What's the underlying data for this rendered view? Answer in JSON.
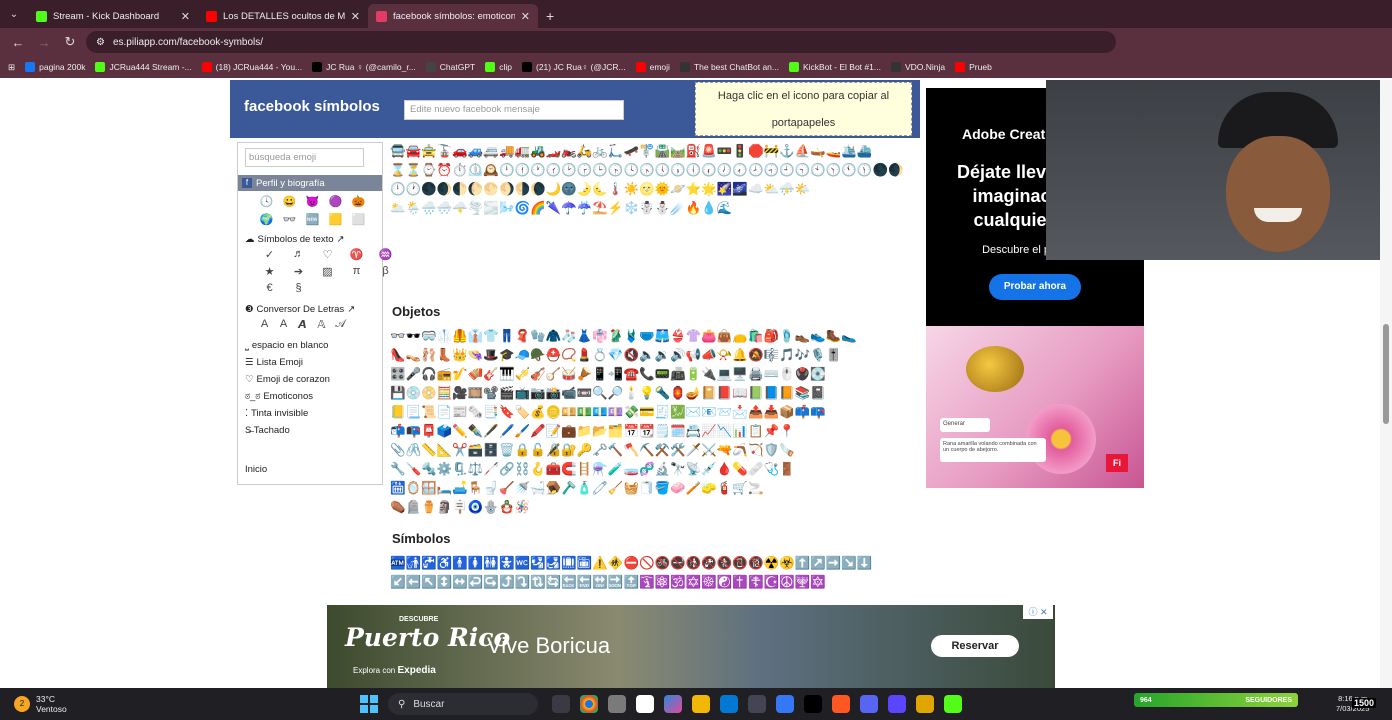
{
  "tabs": [
    {
      "title": "Stream - Kick Dashboard",
      "color": "#53fc18",
      "active": false
    },
    {
      "title": "Los DETALLES ocultos de MUJE",
      "color": "#ff0000",
      "active": false
    },
    {
      "title": "facebook símbolos: emoticone",
      "color": "#e33b66",
      "active": true
    }
  ],
  "tab_close": "✕",
  "new_tab": "+",
  "tab_menu": "⌄",
  "nav": {
    "back": "←",
    "forward": "→",
    "reload": "↻",
    "site_info": "⚙"
  },
  "url": "es.piliapp.com/facebook-symbols/",
  "bookmarks_icon": "⊞",
  "bookmarks": [
    {
      "label": "pagina 200k",
      "color": "#1877f2"
    },
    {
      "label": "JCRua444 Stream -...",
      "color": "#53fc18"
    },
    {
      "label": "(18) JCRua444 - You...",
      "color": "#ff0000"
    },
    {
      "label": "JC Rua ♀ (@camilo_r...",
      "color": "#000000"
    },
    {
      "label": "ChatGPT",
      "color": "#444444"
    },
    {
      "label": "clip",
      "color": "#53fc18"
    },
    {
      "label": "(21) JC Rua♀ (@JCR...",
      "color": "#000000"
    },
    {
      "label": "emoji",
      "color": "#ff0000"
    },
    {
      "label": "The best ChatBot an...",
      "color": "#333333"
    },
    {
      "label": "KickBot - El Bot #1...",
      "color": "#53fc18"
    },
    {
      "label": "VDO.Ninja",
      "color": "#333333"
    },
    {
      "label": "Prueb",
      "color": "#ff0000"
    }
  ],
  "header": {
    "logo": "facebook símbolos",
    "input_placeholder": "Edite nuevo facebook mensaje",
    "copy_hint_line1": "Haga clic en el icono para copiar al",
    "copy_hint_line2": "portapapeles"
  },
  "sidebar": {
    "search_placeholder": "búsqueda emoji",
    "profile_badge": "f",
    "profile_label": "Perfil y biografía",
    "icons": [
      "🕓",
      "😀",
      "😈",
      "🟣",
      "🎃",
      "🌍",
      "👓",
      "🆕",
      "🟨",
      "⬜"
    ],
    "text_symbols_icon": "☁",
    "text_symbols_label": "Símbolos de texto",
    "external_icon": "↗",
    "text_symbols": [
      "✓",
      "♬",
      "♡",
      "♈",
      "♒",
      "★",
      "➔",
      "▨",
      "π",
      "β",
      "€",
      "§"
    ],
    "letter_icon": "❸",
    "letter_converter": "Conversor De Letras",
    "blank_icon": "⎵",
    "blank_space": "espacio en blanco",
    "list_icon": "☰",
    "emoji_list": "Lista Emoji",
    "heart_icon": "♡",
    "heart_emoji": "Emoji de corazon",
    "emoticon_icon": "ಠ_ಠ",
    "emoticons": "Emoticonos",
    "ink_icon": "⁚",
    "invisible_ink": "Tinta invisible",
    "strike_label": "S̶ Tachado",
    "home": "Inicio"
  },
  "content": {
    "travel_rows": [
      "🚍🚘🚖🚡🚗🚙🚐🚚🚛🚜🏎️🏍️🛵🚲🛴🛹🚏🛣️🛤️⛽🚨🚥🚦🛑🚧⚓⛵🛶🚤🛳️⛴️",
      "⌛⏳⌚⏰⏱️⏲️🕰️🕛🕧🕐🕜🕑🕝🕒🕞🕓🕟🕔🕠🕕🕡🕖🕢🕗🕣🕘🕤🕙🕥🕚🕦🌑🌒",
      "🕛🕐🌑🌒🌓🌔🌕🌖🌗🌘🌙🌚🌛🌜🌡️☀️🌝🌞🪐⭐🌟🌠🌌☁️⛅⛈️🌤️",
      "🌥️🌦️🌧️🌨️🌩️🌪️🌫️🌬️🌀🌈🌂☂️☔⛱️⚡❄️☃️⛄☄️🔥💧🌊"
    ],
    "objects_title": "Objetos",
    "objects_rows": [
      "👓🕶️🥽🥼🦺👔👕👖🧣🧤🧥🧦👗👘🥻🩱🩲🩳👙👚👛👜👝🛍️🎒🩴👞👟🥾🥿",
      "👠👡🩰👢👑👒🎩🎓🧢🪖⛑️📿💄💍💎🔇🔈🔉🔊📢📣📯🔔🔕🎼🎵🎶🎙️🎚️",
      "🎛️🎤🎧📻🎷🪗🎸🎹🎺🎻🪕🥁🪘📱📲☎️📞📟📠🔋🔌💻🖥️🖨️⌨️🖱️🖲️💽",
      "💾💿📀🧮🎥🎞️📽️🎬📺📷📸📹📼🔍🔎🕯️💡🔦🏮🪔📔📕📖📗📘📙📚📓",
      "📒📃📜📄📰🗞️📑🔖🏷️💰🪙💴💵💶💷💸💳🧾💹✉️📧📨📩📤📥📦📫📪",
      "📬📭📮🗳️✏️✒️🖋️🖊️🖌️🖍️📝💼📁📂🗂️📅📆🗒️🗓️📇📈📉📊📋📌📍",
      "📎🖇️📏📐✂️🗃️🗄️🗑️🔒🔓🔏🔐🔑🗝️🔨🪓⛏️⚒️🛠️🗡️⚔️🔫🪃🏹🛡️🪚",
      "🔧🪛🔩⚙️🗜️⚖️🦯🔗⛓️🪝🧰🧲🪜⚗️🧪🧫🧬🔬🔭📡💉🩸💊🩹🩺🚪",
      "🛗🪞🪟🛏️🛋️🪑🚽🪠🚿🛁🪤🪒🧴🧷🧹🧺🧻🪣🧼🪥🧽🧯🛒🚬",
      "⚰️🪦⚱️🗿🪧🧿🪬🪆🪅"
    ],
    "symbols_title": "Símbolos",
    "symbols_rows": [
      "🏧🚮🚰♿🚹🚺🚻🚼🚾🛂🛃🛄🛅⚠️🚸⛔🚫🚳🚭🚯🚱🚷📵🔞☢️☣️⬆️↗️➡️↘️⬇️",
      "↙️⬅️↖️↕️↔️↩️↪️⤴️⤵️🔃🔄🔙🔚🔛🔜🔝🛐⚛️🕉️✡️☸️☯️✝️☦️☪️☮️🕎🔯"
    ],
    "collapse_icon": "⌄"
  },
  "ad_right": {
    "brand": "Adobe Creative Cloud",
    "headline": "Déjate llevar por tu imaginación en cualquier lugar",
    "sub": "Descubre el plan Pro.",
    "cta": "Probar ahora",
    "gen_label": "Generar",
    "prompt_text": "Rana amarilla volando combinada con un cuerpo de abejorro.",
    "badge": "Fi"
  },
  "bottom_ad": {
    "descubre": "DESCUBRE",
    "brand": "Puerto Rico",
    "explora": "Explora con",
    "expedia": "Expedia",
    "slogan": "Vive Boricua",
    "cta": "Reservar",
    "close": "ⓘ ✕"
  },
  "taskbar": {
    "temp": "33°C",
    "condition": "Ventoso",
    "weather_badge": "2",
    "search_icon": "⚲",
    "search": "Buscar",
    "app_colors": [
      "#3a3a44",
      "#1a73e8",
      "#7a7a7a",
      "#ffffff",
      "#2b88d8",
      "#f2b705",
      "#0078d4",
      "#444455",
      "#3478f6",
      "#000000",
      "#ff5722",
      "#5865f2",
      "#5b45ff",
      "#e0a500",
      "#53fc18"
    ],
    "followers_left": "964",
    "followers_label": "SEGUIDORES",
    "followers_right": "1500",
    "time": "8:16 p.m.",
    "date": "7/03/2025"
  }
}
